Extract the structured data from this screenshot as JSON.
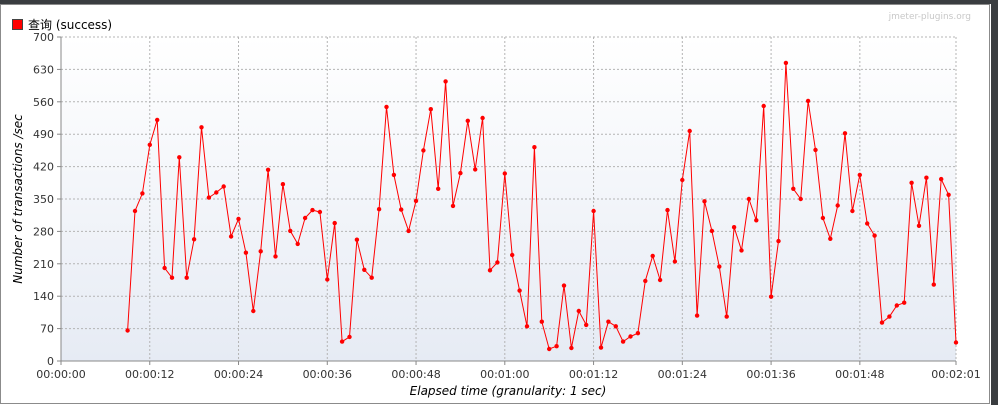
{
  "legend": {
    "label": "查询 (success)",
    "color": "#ff0000"
  },
  "watermark": "jmeter-plugins.org",
  "chart_data": {
    "type": "line",
    "xlabel": "Elapsed time (granularity: 1 sec)",
    "ylabel": "Number of transactions /sec",
    "ylim": [
      0,
      700
    ],
    "yticks": [
      "0",
      "70",
      "140",
      "210",
      "280",
      "350",
      "420",
      "490",
      "560",
      "630",
      "700"
    ],
    "xlim": [
      "00:00:00",
      "00:02:01"
    ],
    "xticks": [
      "00:00:00",
      "00:00:12",
      "00:00:24",
      "00:00:36",
      "00:00:48",
      "00:01:00",
      "00:01:12",
      "00:01:24",
      "00:01:36",
      "00:01:48",
      "00:02:01"
    ],
    "grid": true,
    "legend_position": "top-left",
    "series": [
      {
        "name": "查询 (success)",
        "color": "#ff0000",
        "x": [
          "00:00:09",
          "00:00:10",
          "00:00:11",
          "00:00:12",
          "00:00:13",
          "00:00:14",
          "00:00:15",
          "00:00:16",
          "00:00:17",
          "00:00:18",
          "00:00:19",
          "00:00:20",
          "00:00:21",
          "00:00:22",
          "00:00:23",
          "00:00:24",
          "00:00:25",
          "00:00:26",
          "00:00:27",
          "00:00:28",
          "00:00:29",
          "00:00:30",
          "00:00:31",
          "00:00:32",
          "00:00:33",
          "00:00:34",
          "00:00:35",
          "00:00:36",
          "00:00:37",
          "00:00:38",
          "00:00:39",
          "00:00:40",
          "00:00:41",
          "00:00:42",
          "00:00:43",
          "00:00:44",
          "00:00:45",
          "00:00:46",
          "00:00:47",
          "00:00:48",
          "00:00:49",
          "00:00:50",
          "00:00:51",
          "00:00:52",
          "00:00:53",
          "00:00:54",
          "00:00:55",
          "00:00:56",
          "00:00:57",
          "00:00:58",
          "00:00:59",
          "00:01:00",
          "00:01:01",
          "00:01:02",
          "00:01:03",
          "00:01:04",
          "00:01:05",
          "00:01:06",
          "00:01:07",
          "00:01:08",
          "00:01:09",
          "00:01:10",
          "00:01:11",
          "00:01:12",
          "00:01:13",
          "00:01:14",
          "00:01:15",
          "00:01:16",
          "00:01:17",
          "00:01:18",
          "00:01:19",
          "00:01:20",
          "00:01:21",
          "00:01:22",
          "00:01:23",
          "00:01:24",
          "00:01:25",
          "00:01:26",
          "00:01:27",
          "00:01:28",
          "00:01:29",
          "00:01:30",
          "00:01:31",
          "00:01:32",
          "00:01:33",
          "00:01:34",
          "00:01:35",
          "00:01:36",
          "00:01:37",
          "00:01:38",
          "00:01:39",
          "00:01:40",
          "00:01:41",
          "00:01:42",
          "00:01:43",
          "00:01:44",
          "00:01:45",
          "00:01:46",
          "00:01:47",
          "00:01:48",
          "00:01:49",
          "00:01:50",
          "00:01:51",
          "00:01:52",
          "00:01:53",
          "00:01:54",
          "00:01:55",
          "00:01:56",
          "00:01:57",
          "00:01:58",
          "00:01:59",
          "00:02:00",
          "00:02:01"
        ],
        "values": [
          66,
          324,
          362,
          467,
          521,
          201,
          180,
          440,
          180,
          263,
          505,
          353,
          364,
          377,
          269,
          307,
          234,
          108,
          237,
          413,
          226,
          382,
          281,
          253,
          309,
          326,
          322,
          176,
          298,
          42,
          52,
          262,
          197,
          180,
          328,
          549,
          402,
          327,
          281,
          346,
          455,
          544,
          372,
          604,
          335,
          406,
          519,
          414,
          525,
          196,
          213,
          405,
          229,
          152,
          75,
          462,
          85,
          26,
          32,
          163,
          28,
          108,
          78,
          324,
          29,
          85,
          75,
          42,
          53,
          60,
          173,
          227,
          175,
          326,
          215,
          391,
          497,
          98,
          345,
          281,
          204,
          96,
          289,
          239,
          350,
          304,
          551,
          139,
          259,
          644,
          372,
          350,
          562,
          456,
          309,
          264,
          336,
          492,
          324,
          402,
          297,
          271,
          83,
          96,
          120,
          126,
          385,
          292,
          396,
          165,
          393,
          359,
          40
        ]
      }
    ]
  }
}
